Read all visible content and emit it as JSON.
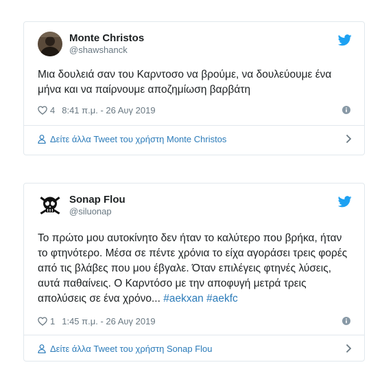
{
  "tweets": [
    {
      "display_name": "Monte Christos",
      "handle": "@shawshanck",
      "text": "Μια δουλειά σαν του Καρντοσο να βρούμε, να δουλεύουμε ένα μήνα και να παίρνουμε αποζημίωση βαρβάτη",
      "likes": "4",
      "timestamp": "8:41 π.μ. - 26 Αυγ 2019",
      "more_link": "Δείτε άλλα Tweet του χρήστη Monte Christos"
    },
    {
      "display_name": "Sonap Flou",
      "handle": "@siluonap",
      "text": "Το πρώτο μου αυτοκίνητο δεν ήταν το καλύτερο που βρήκα, ήταν το φτηνότερο. Μέσα σε πέντε χρόνια το είχα αγοράσει τρεις φορές από τις βλάβες που μου έβγαλε. Όταν επιλέγεις φτηνές λύσεις, αυτά παθαίνεις. Ο Καρντόσο με την αποφυγή μετρά τρεις απολύσεις σε ένα χρόνο...",
      "hashtags": [
        "#aekxan",
        "#aekfc"
      ],
      "likes": "1",
      "timestamp": "1:45 π.μ. - 26 Αυγ 2019",
      "more_link": "Δείτε άλλα Tweet του χρήστη Sonap Flou"
    }
  ],
  "icons": {
    "brand": "twitter-bird-icon",
    "like": "heart-icon",
    "info": "info-icon",
    "profile": "person-icon",
    "chevron": "chevron-right-icon"
  },
  "colors": {
    "brand_blue": "#1da1f2",
    "link_blue": "#2b7bb9",
    "muted": "#697882",
    "border": "#e1e8ed"
  }
}
